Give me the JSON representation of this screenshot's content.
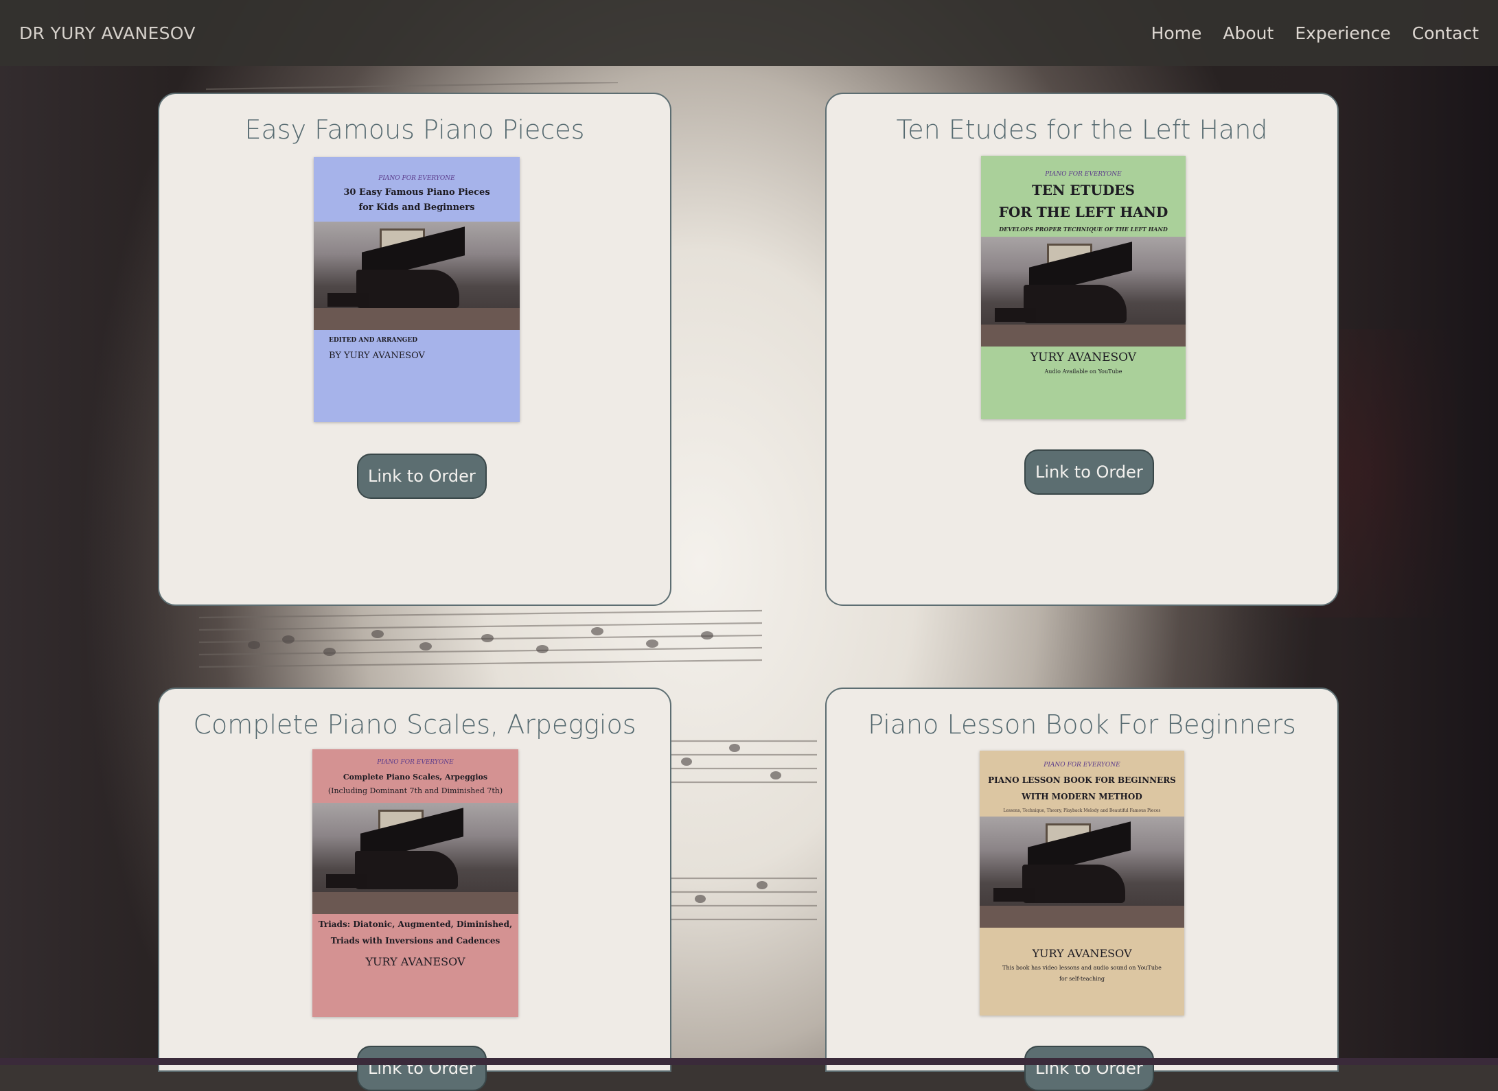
{
  "header": {
    "brand": "DR YURY AVANESOV",
    "nav": [
      "Home",
      "About",
      "Experience",
      "Contact"
    ]
  },
  "books": [
    {
      "title": "Easy Famous Piano Pieces",
      "button": "Link to Order",
      "cover": {
        "color": "#a6b3ea",
        "series": "PIANO FOR EVERYONE",
        "title_line1": "30 Easy Famous Piano Pieces",
        "title_line2": "for Kids and Beginners",
        "foot_line1": "EDITED AND ARRANGED",
        "foot_line2": "BY YURY AVANESOV"
      }
    },
    {
      "title": "Ten Etudes for the Left Hand",
      "button": "Link to Order",
      "cover": {
        "color": "#aad09a",
        "series": "PIANO FOR EVERYONE",
        "title_line1": "TEN ETUDES",
        "title_line2": "FOR THE LEFT HAND",
        "subtitle": "DEVELOPS PROPER TECHNIQUE OF THE LEFT HAND",
        "foot_line1": "YURY AVANESOV",
        "foot_line2": "Audio Available on YouTube"
      }
    },
    {
      "title": "Complete Piano Scales, Arpeggios",
      "button": "Link to Order",
      "cover": {
        "color": "#d49292",
        "series": "PIANO FOR EVERYONE",
        "title_line1": "Complete Piano Scales, Arpeggios",
        "title_line2": "(Including Dominant 7th and Diminished 7th)",
        "foot_line1": "Triads: Diatonic, Augmented, Diminished,",
        "foot_line2": "Triads with Inversions and Cadences",
        "foot_line3": "YURY AVANESOV"
      }
    },
    {
      "title": "Piano Lesson Book For Beginners",
      "button": "Link to Order",
      "cover": {
        "color": "#dcc6a2",
        "series": "PIANO FOR EVERYONE",
        "title_line1": "PIANO LESSON BOOK FOR BEGINNERS",
        "title_line2": "WITH MODERN METHOD",
        "subtitle": "Lessons, Technique, Theory, Playback Melody and Beautiful Famous Pieces",
        "foot_line1": "YURY AVANESOV",
        "foot_line2": "This book has video lessons and audio sound on YouTube",
        "foot_line3": "for self-teaching"
      }
    }
  ]
}
